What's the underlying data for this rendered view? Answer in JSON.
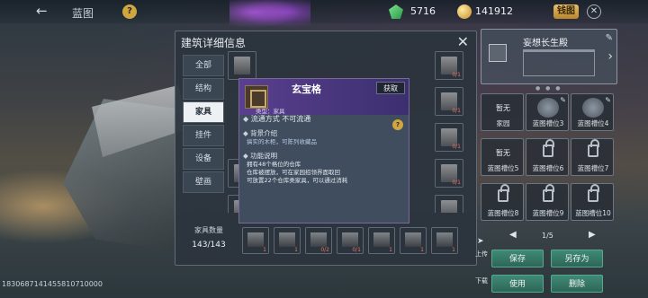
{
  "top_bar": {
    "back_icon": "arrow-left-icon",
    "map_name": "蓝图",
    "help_label": "?",
    "gems": "5716",
    "coins": "141912",
    "cta_label": "钱图",
    "close_label": "✕"
  },
  "panel": {
    "title": "建筑详细信息",
    "close_label": "✕",
    "tabs": [
      {
        "label": "全部"
      },
      {
        "label": "结构"
      },
      {
        "label": "家具"
      },
      {
        "label": "挂件"
      },
      {
        "label": "设备"
      },
      {
        "label": "壁画"
      }
    ],
    "active_tab": 2,
    "grid_slots": [
      {
        "count": ""
      },
      {
        "count": "0/1"
      },
      {
        "count": ""
      },
      {
        "count": "0/1"
      },
      {
        "count": ""
      },
      {
        "count": "0/1"
      },
      {
        "count": ""
      },
      {
        "count": "0/1"
      }
    ],
    "popup": {
      "name": "玄宝格",
      "get_label": "获取",
      "type_text": "类型：家具",
      "circulation": "流通方式   不可流通",
      "help_label": "?",
      "bg_title": "背景介绍",
      "bg_text": "搞实的木柜，可陈列收藏品",
      "func_title": "功能说明",
      "func_lines": [
        "拥有48个格位的仓库",
        "仓库被摆放，可在家园招领界面取回",
        "可放置22个仓库类家具，可以通过消耗"
      ]
    },
    "count_label": "家具数量",
    "count_value": "143/143",
    "bottom_slots": [
      {
        "count": "1"
      },
      {
        "count": "1"
      },
      {
        "count": "0/2"
      },
      {
        "count": "0/1"
      },
      {
        "count": "1"
      },
      {
        "count": "1"
      },
      {
        "count": "1"
      }
    ]
  },
  "right": {
    "palace_name": "妄想长生殿",
    "slots": [
      {
        "status": "暂无",
        "label": "家园",
        "locked": false,
        "thumb": false
      },
      {
        "status": "",
        "label": "蓝图槽位3",
        "locked": false,
        "thumb": true
      },
      {
        "status": "",
        "label": "蓝图槽位4",
        "locked": false,
        "thumb": true
      },
      {
        "status": "暂无",
        "label": "蓝图槽位5",
        "locked": false,
        "thumb": false
      },
      {
        "status": "",
        "label": "蓝图槽位6",
        "locked": true,
        "thumb": false
      },
      {
        "status": "",
        "label": "蓝图槽位7",
        "locked": true,
        "thumb": false
      },
      {
        "status": "",
        "label": "蓝图槽位8",
        "locked": true,
        "thumb": false
      },
      {
        "status": "",
        "label": "蓝图槽位9",
        "locked": true,
        "thumb": false
      },
      {
        "status": "",
        "label": "蓝图槽位10",
        "locked": true,
        "thumb": false
      }
    ],
    "page": "1/5",
    "upload_label": "上传",
    "download_label": "下载",
    "save_label": "保存",
    "save_as_label": "另存为",
    "use_label": "使用",
    "delete_label": "删除"
  },
  "uid": "1830687141455810710000"
}
